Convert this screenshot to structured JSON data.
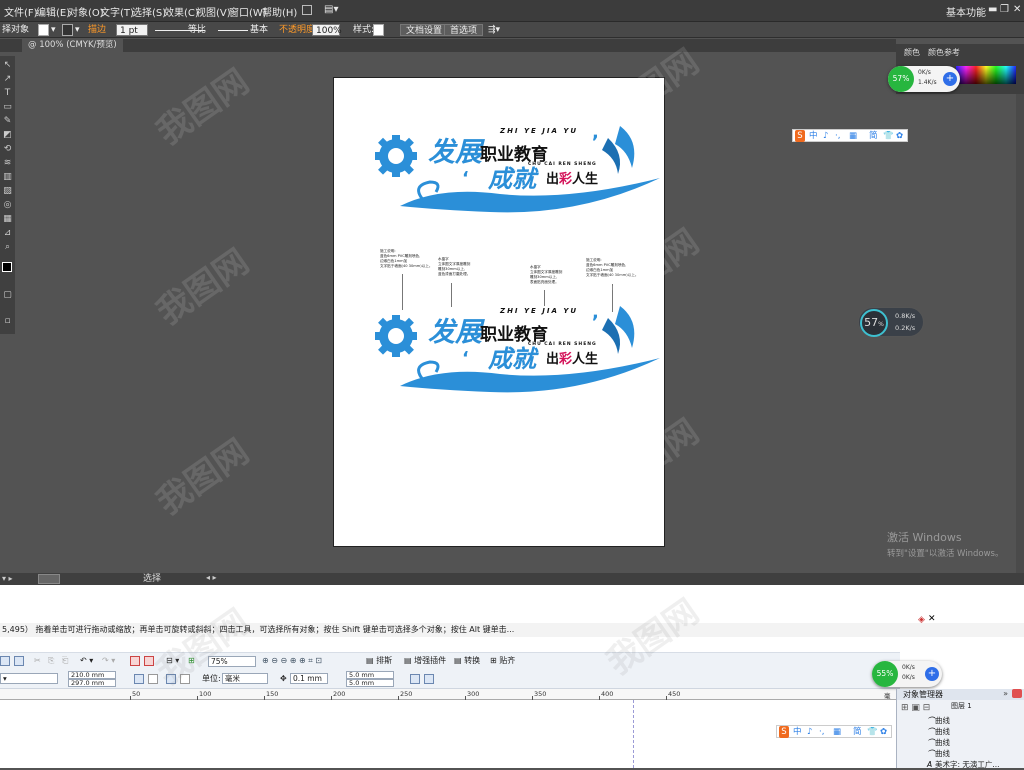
{
  "illustrator": {
    "menu": [
      "文件(F)",
      "编辑(E)",
      "对象(O)",
      "文字(T)",
      "选择(S)",
      "效果(C)",
      "视图(V)",
      "窗口(W)",
      "帮助(H)"
    ],
    "workspace_label": "基本功能",
    "control_bar": {
      "selection_label": "择对象",
      "stroke_label": "描边",
      "stroke_weight": "1 pt",
      "profile_label": "等比",
      "brush_label": "基本",
      "opacity_label": "不透明度",
      "opacity_value": "100%",
      "style_label": "样式:",
      "doc_setup_button": "文档设置",
      "preferences_button": "首选项"
    },
    "document_tab": "@ 100% (CMYK/预览)",
    "panel_tabs": [
      "颜色",
      "颜色参考"
    ],
    "status_text": "选择",
    "artwork": {
      "title_1": "发展",
      "title_1b": "职业教育",
      "pinyin_1": "ZHI YE JIA YU",
      "pinyin_2": "CHU CAI REN SHENG",
      "title_2": "成就",
      "title_2_pre": "出",
      "title_2_red": "彩",
      "title_2_post": "人生",
      "notes": [
        {
          "text": "施工说明:\n蓝色6mm PVC雕刻喷色,\n边缘白色1mm加\n文字贴于墙面(40 30mm)以上。"
        },
        {
          "text": "水晶字\n立体图文字厚度雕刻\n雕刻30mm以上,\n蓝色漆面打磨处理。"
        },
        {
          "text": "水晶字\n立体图文字厚度雕刻\n雕刻30mm以上,\n表面贴亮面处理。"
        },
        {
          "text": "施工说明:\n蓝色6mm PVC雕刻喷色,\n边缘白色1mm加\n文字贴于墙面(40 30mm)以上。"
        }
      ]
    }
  },
  "net_monitor_1": {
    "percent": "57%",
    "up": "0K/s",
    "down": "1.4K/s"
  },
  "net_monitor_dark": {
    "percent": "57",
    "unit": "%",
    "up": "0.8K/s",
    "down": "0.2K/s"
  },
  "net_monitor_2": {
    "percent": "55%",
    "up": "0K/s",
    "down": "0K/s"
  },
  "ime_toolbar": [
    "中",
    "♪",
    "·,",
    "▦",
    "简",
    "👕",
    "✿"
  ],
  "windows_activation": {
    "line1": "激活 Windows",
    "line2": "转到\"设置\"以激活 Windows。"
  },
  "coreldraw": {
    "hint": "5,495）   拖着单击可进行拖动或缩放；再单击可旋转或斜斜；四击工具，可选择所有对象；按住 Shift 键单击可选择多个对象；按住 Alt 键单击...",
    "zoom": "75%",
    "snap_buttons": [
      "排斯",
      "增强插件",
      "转换",
      "贴齐"
    ],
    "width": "210.0 mm",
    "height": "297.0 mm",
    "unit_label": "单位:",
    "unit_value": "毫米",
    "nudge": "0.1 mm",
    "dup_x": "5.0 mm",
    "dup_y": "5.0 mm",
    "ruler": [
      "50",
      "100",
      "150",
      "200",
      "250",
      "300",
      "350",
      "400",
      "450"
    ],
    "ruler_unit": "毫米",
    "object_manager": {
      "title": "对象管理器",
      "layer": "图层 1",
      "items": [
        "曲线",
        "曲线",
        "曲线",
        "曲线",
        "美术字: 无演工广..."
      ]
    }
  },
  "watermark": "我图网"
}
